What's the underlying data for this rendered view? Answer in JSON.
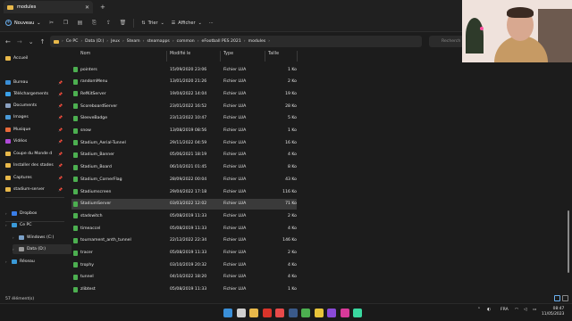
{
  "window": {
    "tab_title": "modules",
    "close_glyph": "✕",
    "new_tab_glyph": "+"
  },
  "toolbar": {
    "new_label": "Nouveau",
    "sort_label": "Trier",
    "view_label": "Afficher",
    "more_label": "···"
  },
  "address": {
    "path": [
      "Ce PC",
      "Data (D:)",
      "Jeux",
      "Steam",
      "steamapps",
      "common",
      "eFootball PES 2021",
      "modules"
    ],
    "search_placeholder": "Recherch"
  },
  "sidebar": {
    "items": [
      {
        "label": "Accueil",
        "icon": "home-icon",
        "color": "#e8b84a",
        "pinned": false,
        "chev": false
      },
      {
        "label": "Bureau",
        "icon": "desktop-icon",
        "color": "#3a8fd8",
        "pinned": true,
        "chev": false
      },
      {
        "label": "Téléchargements",
        "icon": "download-icon",
        "color": "#3aa0e8",
        "pinned": true,
        "chev": false
      },
      {
        "label": "Documents",
        "icon": "document-icon",
        "color": "#8aa0c0",
        "pinned": true,
        "chev": false
      },
      {
        "label": "Images",
        "icon": "image-icon",
        "color": "#4a9ad8",
        "pinned": true,
        "chev": false
      },
      {
        "label": "Musique",
        "icon": "music-icon",
        "color": "#e86a3a",
        "pinned": true,
        "chev": false
      },
      {
        "label": "Vidéos",
        "icon": "video-icon",
        "color": "#b04ad8",
        "pinned": true,
        "chev": false
      },
      {
        "label": "Coupe du Monde d",
        "icon": "folder-icon",
        "color": "#e8b84a",
        "pinned": true,
        "chev": false
      },
      {
        "label": "Installer des stades",
        "icon": "folder-icon",
        "color": "#e8b84a",
        "pinned": true,
        "chev": false
      },
      {
        "label": "Captures",
        "icon": "folder-icon",
        "color": "#e8b84a",
        "pinned": true,
        "chev": false
      },
      {
        "label": "stadium-server",
        "icon": "folder-icon",
        "color": "#e8b84a",
        "pinned": true,
        "chev": false
      },
      {
        "label": "Dropbox",
        "icon": "dropbox-icon",
        "color": "#3a7ee8",
        "pinned": false,
        "chev": true
      },
      {
        "label": "Ce PC",
        "icon": "pc-icon",
        "color": "#3a9ad8",
        "pinned": false,
        "chev": true
      },
      {
        "label": "Windows (C:)",
        "icon": "drive-icon",
        "color": "#7aa0c8",
        "pinned": false,
        "chev": true
      },
      {
        "label": "Data (D:)",
        "icon": "drive-icon",
        "color": "#9a9a9a",
        "pinned": false,
        "chev": true
      },
      {
        "label": "Réseau",
        "icon": "network-icon",
        "color": "#3a9ad8",
        "pinned": false,
        "chev": true
      }
    ]
  },
  "columns": {
    "name": "Nom",
    "modified": "Modifié le",
    "type": "Type",
    "size": "Taille"
  },
  "files": [
    {
      "name": "pointers",
      "date": "15/09/2020 23:06",
      "type": "Fichier LUA",
      "size": "1 Ko"
    },
    {
      "name": "randomMenu",
      "date": "13/01/2020 21:26",
      "type": "Fichier LUA",
      "size": "2 Ko"
    },
    {
      "name": "RefKitServer",
      "date": "19/04/2022 14:04",
      "type": "Fichier LUA",
      "size": "19 Ko"
    },
    {
      "name": "ScoreboardServer",
      "date": "23/01/2022 16:52",
      "type": "Fichier LUA",
      "size": "28 Ko"
    },
    {
      "name": "SleeveBadge",
      "date": "23/12/2022 10:47",
      "type": "Fichier LUA",
      "size": "5 Ko"
    },
    {
      "name": "snow",
      "date": "13/08/2019 08:56",
      "type": "Fichier LUA",
      "size": "1 Ko"
    },
    {
      "name": "Stadium_Aerial-Tunnel",
      "date": "29/11/2022 04:59",
      "type": "Fichier LUA",
      "size": "16 Ko"
    },
    {
      "name": "Stadium_Banner",
      "date": "05/06/2021 18:19",
      "type": "Fichier LUA",
      "size": "4 Ko"
    },
    {
      "name": "Stadium_Board",
      "date": "06/10/2021 01:45",
      "type": "Fichier LUA",
      "size": "8 Ko"
    },
    {
      "name": "Stadium_CornerFlag",
      "date": "28/09/2022 00:04",
      "type": "Fichier LUA",
      "size": "43 Ko"
    },
    {
      "name": "Stadiumscreen",
      "date": "29/04/2022 17:18",
      "type": "Fichier LUA",
      "size": "116 Ko"
    },
    {
      "name": "StadiumServer",
      "date": "03/03/2022 12:02",
      "type": "Fichier LUA",
      "size": "71 Ko",
      "selected": true
    },
    {
      "name": "stadswitch",
      "date": "05/08/2019 11:33",
      "type": "Fichier LUA",
      "size": "2 Ko"
    },
    {
      "name": "timeaccel",
      "date": "05/08/2019 11:33",
      "type": "Fichier LUA",
      "size": "4 Ko"
    },
    {
      "name": "tournament_anth_tunnel",
      "date": "22/12/2022 22:34",
      "type": "Fichier LUA",
      "size": "146 Ko"
    },
    {
      "name": "tracer",
      "date": "05/08/2019 11:33",
      "type": "Fichier LUA",
      "size": "2 Ko"
    },
    {
      "name": "trophy",
      "date": "03/10/2019 20:32",
      "type": "Fichier LUA",
      "size": "4 Ko"
    },
    {
      "name": "tunnel",
      "date": "04/10/2022 18:20",
      "type": "Fichier LUA",
      "size": "4 Ko"
    },
    {
      "name": "zlibtest",
      "date": "05/08/2019 11:33",
      "type": "Fichier LUA",
      "size": "1 Ko"
    }
  ],
  "status": {
    "count": "57 élément(s)"
  },
  "taskbar": {
    "apps": [
      "windows-start-icon",
      "search-icon",
      "file-explorer-icon",
      "game-app-icon",
      "opera-icon",
      "steam-icon",
      "xbox-icon",
      "chrome-icon",
      "purple-app-icon",
      "media-app-icon",
      "terminal-app-icon"
    ],
    "tray": {
      "language": "FRA",
      "time": "08:47",
      "date": "11/05/2023"
    }
  },
  "colors": {
    "accent": "#6ab0f0",
    "folder": "#e8b84a",
    "lua_icon": "#4caf50"
  }
}
